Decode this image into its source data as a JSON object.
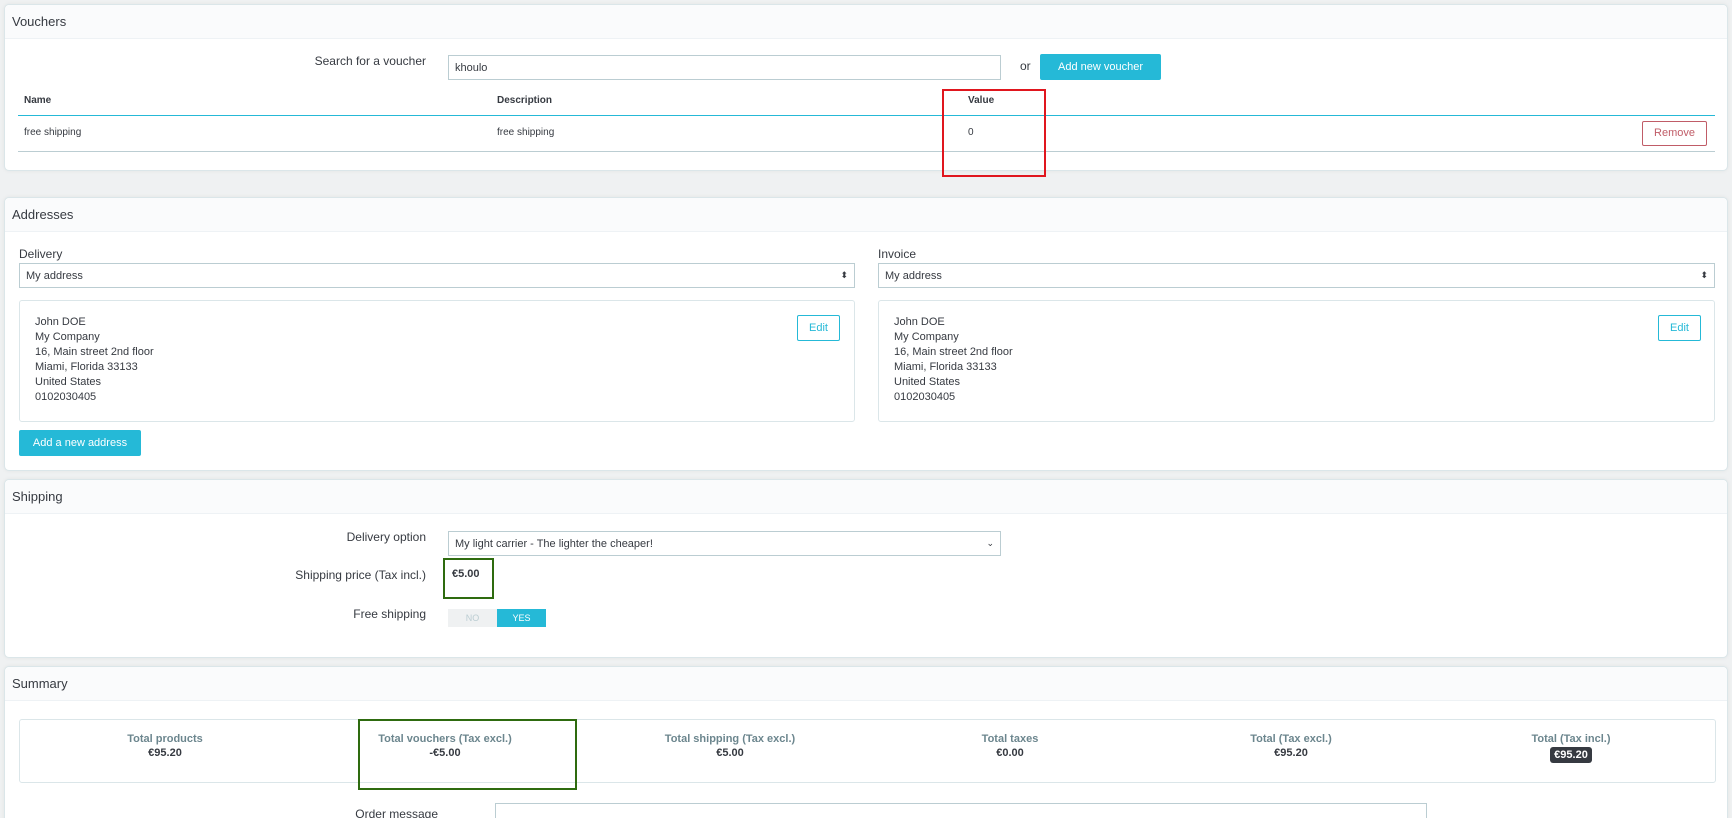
{
  "vouchers": {
    "title": "Vouchers",
    "search_label": "Search for a voucher",
    "search_value": "khoulo",
    "or_text": "or",
    "add_button": "Add new voucher",
    "columns": [
      "Name",
      "Description",
      "Value"
    ],
    "rows": [
      {
        "name": "free shipping",
        "description": "free shipping",
        "value": "0",
        "action": "Remove"
      }
    ]
  },
  "addresses": {
    "title": "Addresses",
    "delivery_label": "Delivery",
    "delivery_selected": "My address",
    "invoice_label": "Invoice",
    "invoice_selected": "My address",
    "delivery_address": [
      "John DOE",
      "My Company",
      "16, Main street 2nd floor",
      "Miami, Florida 33133",
      "United States",
      "0102030405"
    ],
    "invoice_address": [
      "John DOE",
      "My Company",
      "16, Main street 2nd floor",
      "Miami, Florida 33133",
      "United States",
      "0102030405"
    ],
    "edit_label": "Edit",
    "add_address_button": "Add a new address"
  },
  "shipping": {
    "title": "Shipping",
    "delivery_option_label": "Delivery option",
    "delivery_option_selected": "My light carrier - The lighter the cheaper!",
    "price_label": "Shipping price (Tax incl.)",
    "price_value": "€5.00",
    "free_shipping_label": "Free shipping",
    "toggle_no": "NO",
    "toggle_yes": "YES",
    "free_shipping_state": "YES"
  },
  "summary": {
    "title": "Summary",
    "items": [
      {
        "label": "Total products",
        "value": "€95.20"
      },
      {
        "label": "Total vouchers (Tax excl.)",
        "value": "-€5.00"
      },
      {
        "label": "Total shipping (Tax excl.)",
        "value": "€5.00"
      },
      {
        "label": "Total taxes",
        "value": "€0.00"
      },
      {
        "label": "Total (Tax excl.)",
        "value": "€95.20"
      },
      {
        "label": "Total (Tax incl.)",
        "value": "€95.20"
      }
    ],
    "order_message_label": "Order message"
  },
  "colors": {
    "accent": "#25b9d7",
    "danger": "#c05c67",
    "highlight_red": "#e0161e",
    "highlight_green": "#2e6b0f"
  }
}
